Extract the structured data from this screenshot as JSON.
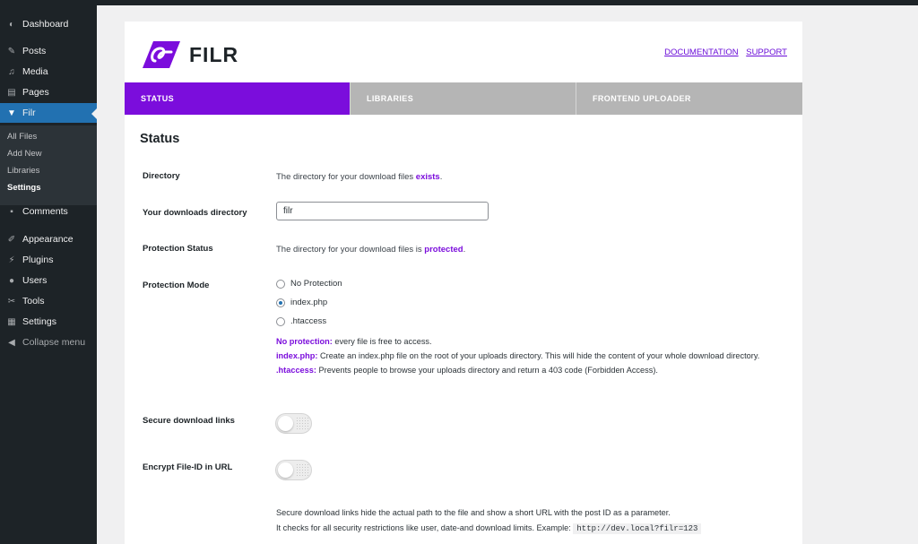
{
  "sidebar": {
    "items": [
      {
        "label": "Dashboard",
        "icon": "dashboard-icon",
        "glyph": "◐"
      },
      {
        "label": "Posts",
        "icon": "pin-icon",
        "glyph": "✎"
      },
      {
        "label": "Media",
        "icon": "media-icon",
        "glyph": "♫"
      },
      {
        "label": "Pages",
        "icon": "pages-icon",
        "glyph": "▤"
      },
      {
        "label": "Filr",
        "icon": "filr-icon",
        "glyph": "▼"
      },
      {
        "label": "Comments",
        "icon": "comments-icon",
        "glyph": "▪"
      },
      {
        "label": "Appearance",
        "icon": "brush-icon",
        "glyph": "✐"
      },
      {
        "label": "Plugins",
        "icon": "plugin-icon",
        "glyph": "⚡"
      },
      {
        "label": "Users",
        "icon": "users-icon",
        "glyph": "●"
      },
      {
        "label": "Tools",
        "icon": "wrench-icon",
        "glyph": "✂"
      },
      {
        "label": "Settings",
        "icon": "settings-icon",
        "glyph": "▦"
      }
    ],
    "submenu": [
      "All Files",
      "Add New",
      "Libraries",
      "Settings"
    ],
    "collapse_label": "Collapse menu",
    "collapse_glyph": "◀"
  },
  "brand": {
    "name": "FILR",
    "accent_color": "#7b0ddc"
  },
  "toplinks": {
    "documentation": "DOCUMENTATION",
    "support": "SUPPORT"
  },
  "tabs": [
    "STATUS",
    "LIBRARIES",
    "FRONTEND UPLOADER"
  ],
  "section_title": "Status",
  "fields": {
    "directory": {
      "label": "Directory",
      "text": "The directory for your download files ",
      "value": "exists",
      "suffix": "."
    },
    "downloads_directory": {
      "label": "Your downloads directory",
      "value": "filr"
    },
    "protection_status": {
      "label": "Protection Status",
      "text": "The directory for your download files is ",
      "value": "protected",
      "suffix": "."
    },
    "protection_mode": {
      "label": "Protection Mode",
      "options": [
        "No Protection",
        "index.php",
        ".htaccess"
      ],
      "selected": "index.php",
      "help": [
        {
          "key": "No protection:",
          "text": " every file is free to access."
        },
        {
          "key": "index.php:",
          "text": " Create an index.php file on the root of your uploads directory. This will hide the content of your whole download directory."
        },
        {
          "key": ".htaccess:",
          "text": " Prevents people to browse your uploads directory and return a 403 code (Forbidden Access)."
        }
      ]
    },
    "secure_links": {
      "label": "Secure download links"
    },
    "encrypt_id": {
      "label": "Encrypt File-ID in URL"
    },
    "secure_help": {
      "line1": "Secure download links hide the actual path to the file and show a short URL with the post ID as a parameter.",
      "line2": "It checks for all security restrictions like user, date-and download limits. Example: ",
      "example": "http://dev.local?filr=123"
    }
  }
}
